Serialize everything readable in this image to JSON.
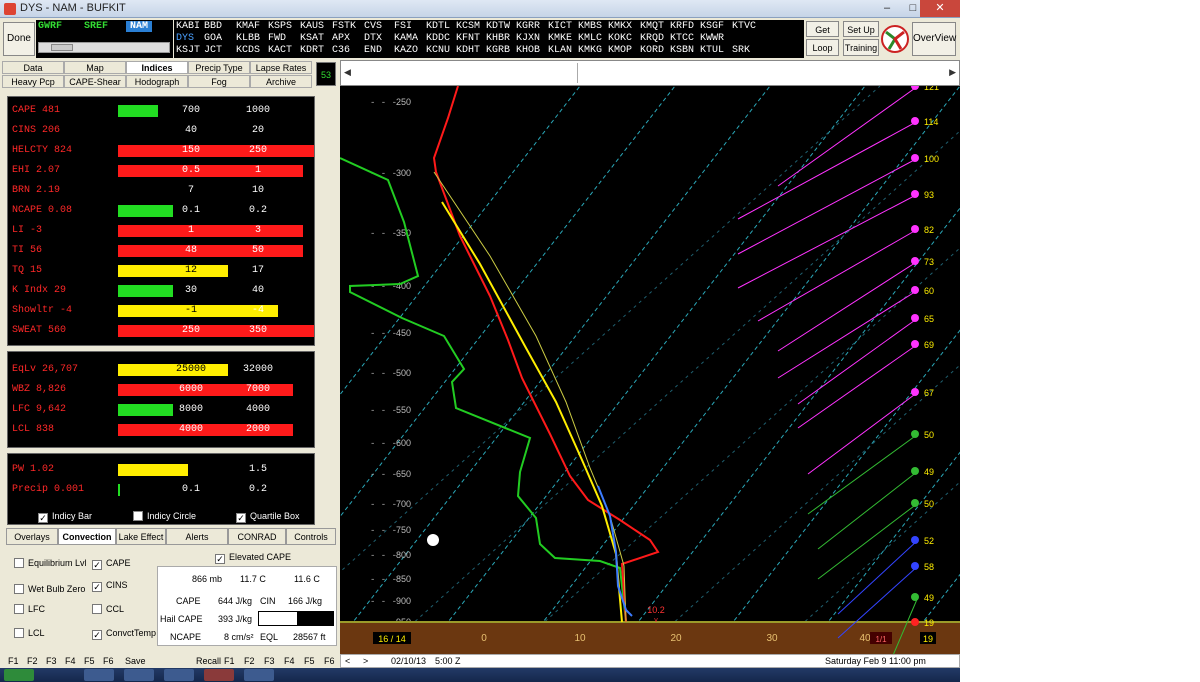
{
  "window": {
    "title": "DYS - NAM - BUFKIT",
    "minimize": "–",
    "maximize": "□",
    "close": "✕"
  },
  "toolbar": {
    "done": "Done",
    "get_data": "Get Data",
    "loop": "Loop",
    "set_up": "Set Up",
    "training": "Training",
    "overview": "OverView",
    "counter": "53"
  },
  "models": [
    {
      "label": "GWRF",
      "selected": false
    },
    {
      "label": "SREF",
      "selected": false
    },
    {
      "label": "NAM",
      "selected": true
    }
  ],
  "station_rows": [
    [
      "KABI",
      "BBD",
      "KMAF",
      "KSPS",
      "KAUS",
      "FSTK",
      "CVS",
      "FSI",
      "KDTL",
      "KCSM",
      "KDTW",
      "KGRR",
      "KICT",
      "KMBS",
      "KMKX",
      "KMQT",
      "KRFD",
      "KSGF",
      "KTVC"
    ],
    [
      "DYS",
      "GOA",
      "KLBB",
      "FWD",
      "KSAT",
      "APX",
      "DTX",
      "KAMA",
      "KDDC",
      "KFNT",
      "KHBR",
      "KJXN",
      "KMKE",
      "KMLC",
      "KOKC",
      "KRQD",
      "KTCC",
      "KWWR"
    ],
    [
      "KSJT",
      "JCT",
      "KCDS",
      "KACT",
      "KDRT",
      "C36",
      "END",
      "KAZO",
      "KCNU",
      "KDHT",
      "KGRB",
      "KHOB",
      "KLAN",
      "KMKG",
      "KMOP",
      "KORD",
      "KSBN",
      "KTUL",
      "SRK"
    ]
  ],
  "selected_station": "DYS",
  "tabs_row1": [
    "Data",
    "Map",
    "Indices",
    "Precip Type",
    "Lapse Rates"
  ],
  "tabs_row2": [
    "Heavy Pcp",
    "CAPE-Shear",
    "Hodograph",
    "Fog",
    "Archive"
  ],
  "active_tab": "Indices",
  "indices": [
    {
      "name": "CAPE 481",
      "bar": "green",
      "t1": "700",
      "t2": "1000"
    },
    {
      "name": "CINS 206",
      "bar": "none",
      "t1": "40",
      "t2": "20"
    },
    {
      "name": "HELCTY 824",
      "bar": "red",
      "t1": "150",
      "t2": "250"
    },
    {
      "name": "EHI 2.07",
      "bar": "red",
      "t1": "0.5",
      "t2": "1"
    },
    {
      "name": "BRN 2.19",
      "bar": "none",
      "t1": "7",
      "t2": "10"
    },
    {
      "name": "NCAPE 0.08",
      "bar": "green",
      "t1": "0.1",
      "t2": "0.2"
    },
    {
      "name": "LI -3",
      "bar": "red",
      "t1": "1",
      "t2": "3"
    },
    {
      "name": "TI 56",
      "bar": "red",
      "t1": "48",
      "t2": "50"
    },
    {
      "name": "TQ 15",
      "bar": "yellow",
      "t1": "12",
      "t2": "17"
    },
    {
      "name": "K Indx 29",
      "bar": "green",
      "t1": "30",
      "t2": "40"
    },
    {
      "name": "Showltr -4",
      "bar": "yellow",
      "t1": "-1",
      "t2": "-4"
    },
    {
      "name": "SWEAT 560",
      "bar": "red",
      "t1": "250",
      "t2": "350"
    }
  ],
  "levels": [
    {
      "name": "EqLv 26,707",
      "bar": "yellow",
      "t1": "25000",
      "t2": "32000"
    },
    {
      "name": "WBZ 8,826",
      "bar": "red",
      "t1": "6000",
      "t2": "7000"
    },
    {
      "name": "LFC 9,642",
      "bar": "green",
      "t1": "8000",
      "t2": "4000"
    },
    {
      "name": "LCL 838",
      "bar": "red",
      "t1": "4000",
      "t2": "2000"
    }
  ],
  "precip": [
    {
      "name": "PW 1.02",
      "bar": "yellow",
      "t1": "1",
      "t2": "1.5"
    },
    {
      "name": "Precip 0.001",
      "bar": "greensmall",
      "t1": "0.1",
      "t2": "0.2"
    }
  ],
  "display_opts": [
    {
      "label": "Indicy Bar",
      "checked": true
    },
    {
      "label": "Indicy Circle",
      "checked": false
    },
    {
      "label": "Quartile Box",
      "checked": true
    }
  ],
  "tabs_bottom": [
    "Overlays",
    "Convection",
    "Lake Effect",
    "Alerts",
    "CONRAD",
    "Controls"
  ],
  "active_bottom_tab": "Convection",
  "conv_opts": [
    {
      "label": "Equilibrium Lvl",
      "checked": false
    },
    {
      "label": "CAPE",
      "checked": true
    },
    {
      "label": "Wet Bulb Zero",
      "checked": false
    },
    {
      "label": "CINS",
      "checked": true
    },
    {
      "label": "LFC",
      "checked": false
    },
    {
      "label": "CCL",
      "checked": false
    },
    {
      "label": "LCL",
      "checked": false
    },
    {
      "label": "ConvctTemp",
      "checked": true
    }
  ],
  "elevated": {
    "label": "Elevated CAPE",
    "checked": true,
    "pres": "866 mb",
    "temp": "11.7 C",
    "dew": "11.6 C",
    "cape_label": "CAPE",
    "cape": "644 J/kg",
    "cin_label": "CIN",
    "cin": "166 J/kg",
    "hail_label": "Hail CAPE",
    "hail": "393 J/kg",
    "ncape_label": "NCAPE",
    "ncape": "8 cm/s²",
    "eql_label": "EQL",
    "eql": "28567 ft"
  },
  "fkeys_left": [
    "F1",
    "F2",
    "F3",
    "F4",
    "F5",
    "F6"
  ],
  "save": "Save",
  "recall": "Recall",
  "fkeys_right": [
    "F1",
    "F2",
    "F3",
    "F4",
    "F5",
    "F6"
  ],
  "bottom_status": {
    "date": "02/10/13",
    "time": "5:00 Z",
    "local": "Saturday  Feb 9 11:00 pm"
  },
  "chart_data": {
    "type": "line",
    "pressure_levels": [
      "250",
      "300",
      "350",
      "400",
      "450",
      "500",
      "550",
      "600",
      "650",
      "700",
      "750",
      "800",
      "850",
      "900",
      "950"
    ],
    "temperature_ticks": [
      "0",
      "10",
      "20",
      "30",
      "40"
    ],
    "low_left_label": "16 / 14",
    "surface_marker": "10.2",
    "surface_marker_right": "1/1",
    "wind_labels": [
      {
        "label": "121",
        "color": "#ff33ff"
      },
      {
        "label": "114",
        "color": "#ff33ff"
      },
      {
        "label": "100",
        "color": "#ff33ff"
      },
      {
        "label": "93",
        "color": "#ff33ff"
      },
      {
        "label": "82",
        "color": "#ff33ff"
      },
      {
        "label": "73",
        "color": "#ff33ff"
      },
      {
        "label": "60",
        "color": "#ff33ff"
      },
      {
        "label": "65",
        "color": "#ff33ff"
      },
      {
        "label": "69",
        "color": "#ff33ff"
      },
      {
        "label": "67",
        "color": "#ff33ff"
      },
      {
        "label": "50",
        "color": "#33bb33"
      },
      {
        "label": "49",
        "color": "#33bb33"
      },
      {
        "label": "50",
        "color": "#33bb33"
      },
      {
        "label": "52",
        "color": "#3344ff"
      },
      {
        "label": "58",
        "color": "#3344ff"
      },
      {
        "label": "49",
        "color": "#33bb33"
      },
      {
        "label": "19",
        "color": "#ff2222"
      }
    ],
    "corner_label": "19"
  }
}
